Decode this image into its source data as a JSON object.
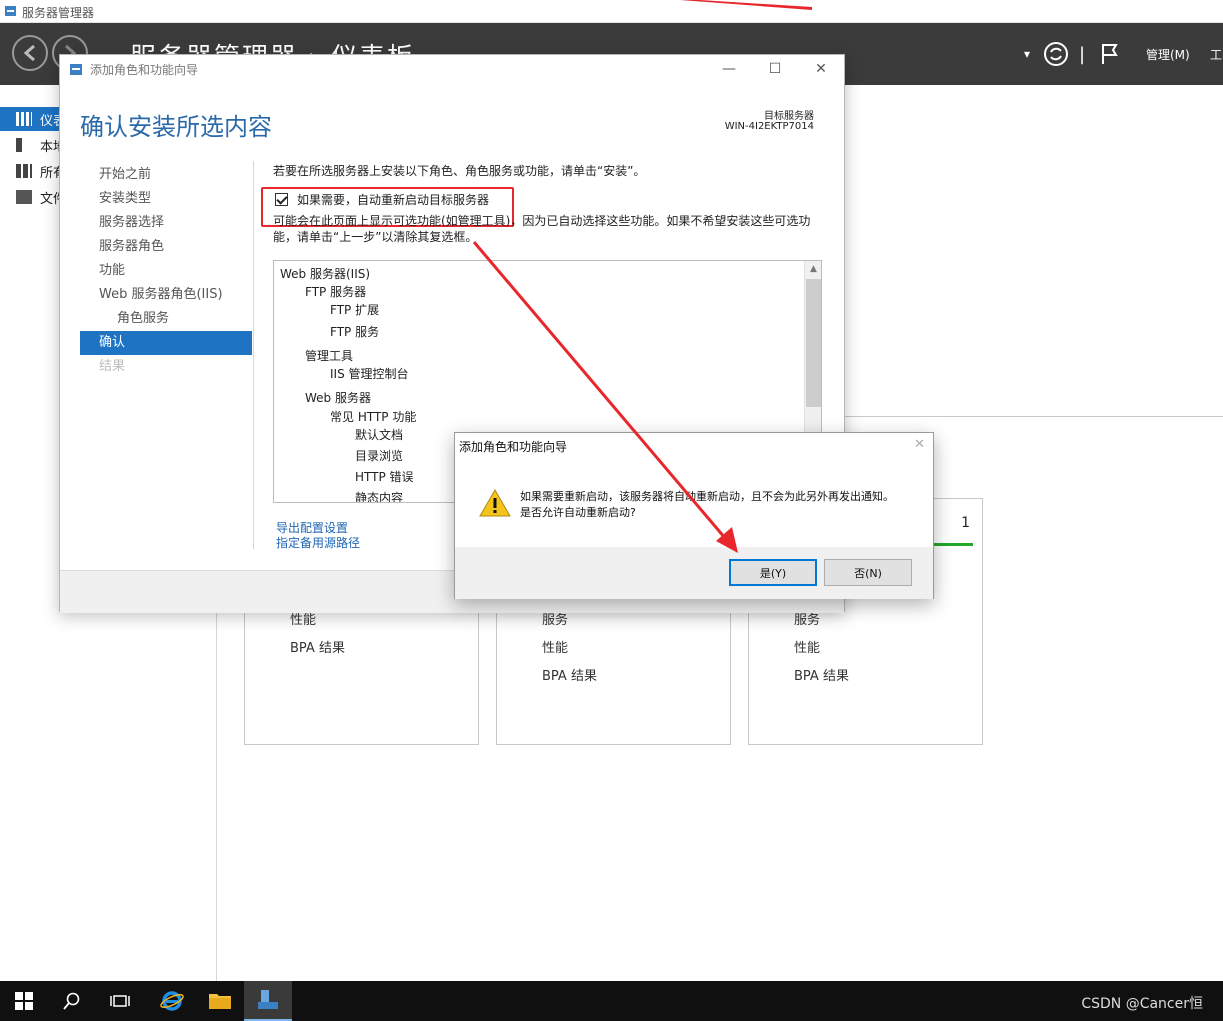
{
  "window": {
    "title": "服务器管理器"
  },
  "header": {
    "breadcrumb": "服务器管理器 › 仪表板",
    "manage": "管理(M)",
    "tools": "工"
  },
  "sidebar": {
    "items": [
      {
        "label": "仪表"
      },
      {
        "label": "本地"
      },
      {
        "label": "所有"
      },
      {
        "label": "文件"
      }
    ]
  },
  "tiles": [
    {
      "lines": [
        "性能",
        "BPA 结果"
      ]
    },
    {
      "lines": [
        "服务",
        "性能",
        "BPA 结果"
      ]
    },
    {
      "lines": [
        "服务",
        "性能",
        "BPA 结果"
      ],
      "count": "1"
    }
  ],
  "wizard": {
    "title": "添加角色和功能向导",
    "heading": "确认安装所选内容",
    "target_label": "目标服务器",
    "target_name": "WIN-4I2EKTP7014",
    "steps": [
      "开始之前",
      "安装类型",
      "服务器选择",
      "服务器角色",
      "功能",
      "Web 服务器角色(IIS)",
      "角色服务",
      "确认",
      "结果"
    ],
    "instruction": "若要在所选服务器上安装以下角色、角色服务或功能，请单击“安装”。",
    "restart_checkbox": "如果需要，自动重新启动目标服务器",
    "note_line1": "可能会在此页面上显示可选功能(如管理工具)，因为已自动选择这些功能。如果不希望安装这些可选功",
    "note_line2": "能，请单击“上一步”以清除其复选框。",
    "features": [
      "Web 服务器(IIS)",
      "FTP 服务器",
      "FTP 扩展",
      "FTP 服务",
      "管理工具",
      "IIS 管理控制台",
      "Web 服务器",
      "常见 HTTP 功能",
      "默认文档",
      "目录浏览",
      "HTTP 错误",
      "静态内容"
    ],
    "link_export": "导出配置设置",
    "link_source": "指定备用源路径"
  },
  "confirm": {
    "title": "添加角色和功能向导",
    "message1": "如果需要重新启动，该服务器将自动重新启动，且不会为此另外再发出通知。",
    "message2": "是否允许自动重新启动?",
    "yes": "是(Y)",
    "no": "否(N)"
  },
  "taskbar": {
    "watermark": "CSDN @Cancer恒"
  },
  "colors": {
    "accent": "#1e74c3",
    "header": "#3b3b3b",
    "annotation": "#e8262b"
  }
}
